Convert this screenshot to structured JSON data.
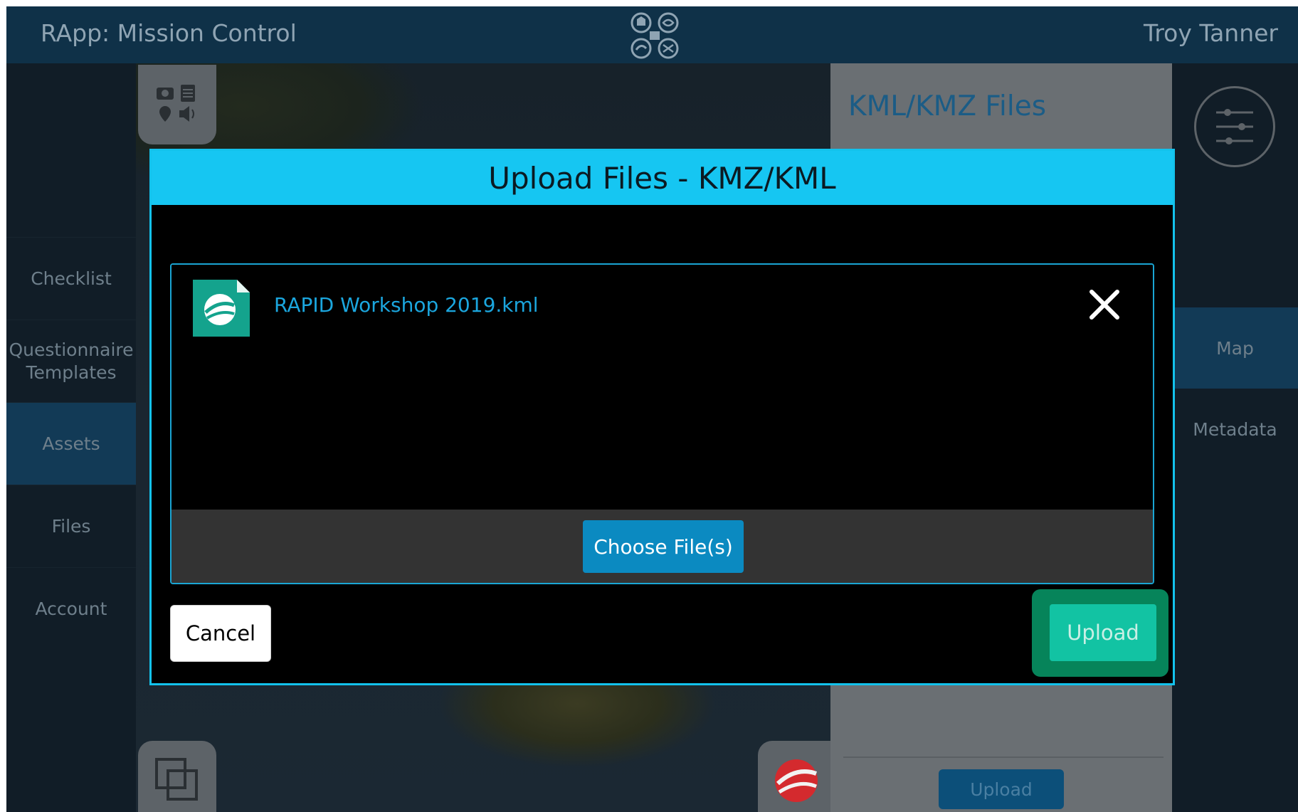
{
  "header": {
    "app_title": "RApp: Mission Control",
    "user_name": "Troy Tanner"
  },
  "left_nav": {
    "items": [
      {
        "label": "Checklist",
        "active": false
      },
      {
        "label": "Questionnaire\nTemplates",
        "active": false
      },
      {
        "label": "Assets",
        "active": true
      },
      {
        "label": "Files",
        "active": false
      },
      {
        "label": "Account",
        "active": false
      }
    ]
  },
  "kml_panel": {
    "title": "KML/KMZ Files",
    "upload_label": "Upload"
  },
  "right_nav": {
    "items": [
      {
        "label": "Map",
        "active": true
      },
      {
        "label": "Metadata",
        "active": false
      }
    ]
  },
  "modal": {
    "title": "Upload Files - KMZ/KML",
    "files": [
      {
        "name": "RAPID Workshop 2019.kml",
        "icon": "google-earth-file-icon"
      }
    ],
    "choose_label": "Choose File(s)",
    "cancel_label": "Cancel",
    "upload_label": "Upload"
  },
  "colors": {
    "header_bg": "#0f3148",
    "modal_accent": "#16c6f2",
    "choose_button": "#0b8ac1",
    "upload_button": "#12c3a3",
    "upload_highlight": "#06845a",
    "file_name_text": "#1ba6de"
  }
}
